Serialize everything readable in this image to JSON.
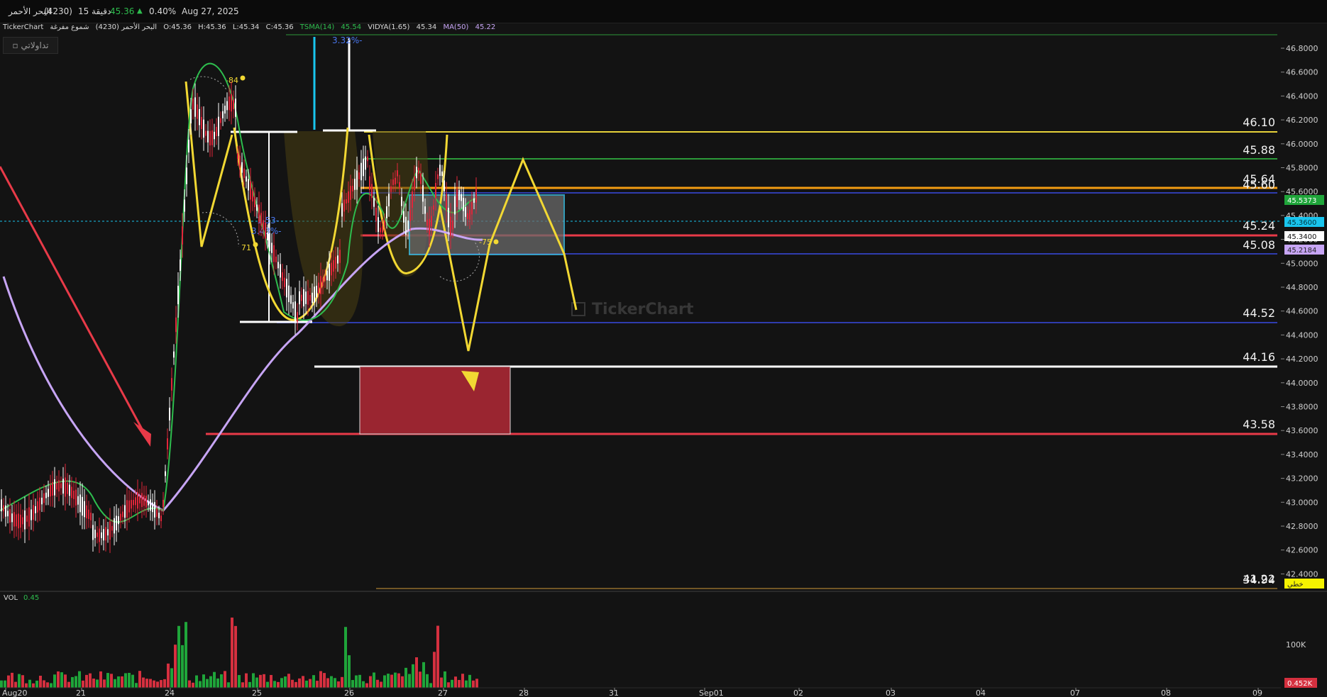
{
  "header": {
    "symbol_name": "البحر الأحمر",
    "symbol_code": "(4230)",
    "interval": "15 دقيقة",
    "last_price": "45.36",
    "change_pct": "0.40%",
    "date": "Aug 27, 2025"
  },
  "info_bar": {
    "source": "TickerChart",
    "symbol": "البحر الأحمر (4230)",
    "candle_type": "شموع مفرغة",
    "open": "O:45.36",
    "high": "H:45.36",
    "low": "L:45.34",
    "close": "C:45.36",
    "tsma_label": "TSMA(14)",
    "tsma_value": "45.54",
    "vidya_label": "VIDYA(1.65)",
    "vidya_value": "45.34",
    "ma_label": "MA(50)",
    "ma_value": "45.22"
  },
  "account_button": "تداولاتي",
  "watermark": "TickerChart",
  "price_axis": {
    "ticks": [
      "46.8000",
      "46.6000",
      "46.4000",
      "46.2000",
      "46.0000",
      "45.8000",
      "45.6000",
      "45.4000",
      "45.2000",
      "45.0000",
      "44.8000",
      "44.6000",
      "44.4000",
      "44.2000",
      "44.0000",
      "43.8000",
      "43.6000",
      "43.4000",
      "43.2000",
      "43.0000",
      "42.8000",
      "42.6000",
      "42.4000"
    ],
    "badges": [
      {
        "text": "45.5373",
        "bg": "#1fa53a",
        "fg": "#ffffff"
      },
      {
        "text": "45.3600",
        "bg": "#19c5ee",
        "fg": "#00343f"
      },
      {
        "text": "45.3400",
        "bg": "#ffffff",
        "fg": "#111111"
      },
      {
        "text": "45.2184",
        "bg": "#c7a5f5",
        "fg": "#222222"
      },
      {
        "text": "خطي",
        "bg": "#f5f200",
        "fg": "#222222"
      }
    ]
  },
  "levels": [
    {
      "label": "46.10",
      "price": 46.1,
      "color": "#e6d23a"
    },
    {
      "label": "45.88",
      "price": 45.88,
      "color": "#2c9a3a"
    },
    {
      "label": "45.64",
      "price": 45.64,
      "color": "#f39c12"
    },
    {
      "label": "45.60",
      "price": 45.6,
      "color": "#2f3cae"
    },
    {
      "label": "45.24",
      "price": 45.24,
      "color": "#e83a48"
    },
    {
      "label": "45.08",
      "price": 45.08,
      "color": "#2f3cae"
    },
    {
      "label": "44.52",
      "price": 44.52,
      "color": "#2f3cae"
    },
    {
      "label": "44.16",
      "price": 44.16,
      "color": "#ffffff"
    },
    {
      "label": "43.58",
      "price": 43.58,
      "color": "#e83a48"
    },
    {
      "label": "41.22",
      "price": null,
      "color": "#d29a3a"
    },
    {
      "label": "34.94",
      "price": null,
      "color": "#d29a3a"
    }
  ],
  "annotations": [
    "-84",
    "71",
    "3.32%-",
    "3.43%-",
    "1.53-",
    "-75"
  ],
  "volume": {
    "label": "VOL",
    "value": "0.45",
    "axis_tick": "100K",
    "badge": "0.452K",
    "badge_bg": "#d5303f"
  },
  "x_axis": [
    "Aug20",
    "21",
    "24",
    "25",
    "26",
    "27",
    "28",
    "31",
    "Sep01",
    "02",
    "03",
    "04",
    "07",
    "08",
    "09"
  ]
}
